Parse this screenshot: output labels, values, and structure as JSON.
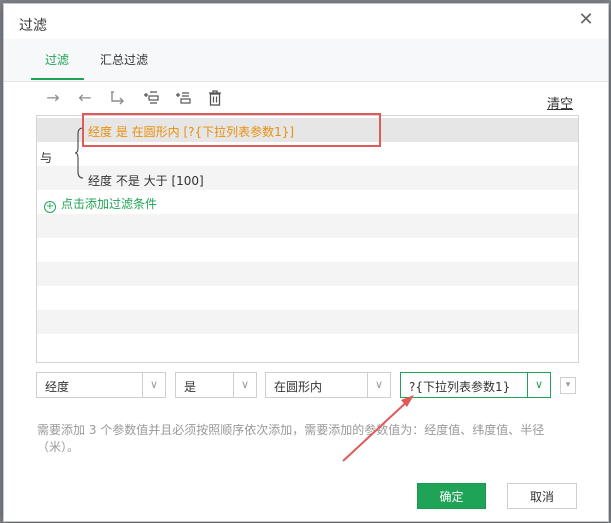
{
  "dialog": {
    "title": "过滤",
    "close_icon": "close-icon"
  },
  "tabs": [
    {
      "label": "过滤",
      "active": true
    },
    {
      "label": "汇总过滤",
      "active": false
    }
  ],
  "toolbar": {
    "icons": [
      "arrow-right-icon",
      "arrow-left-icon",
      "return-arrow-icon",
      "add-condition-icon",
      "add-group-icon",
      "delete-icon"
    ],
    "clear_label": "清空"
  },
  "filter": {
    "and_label": "与",
    "conditions": [
      {
        "text": "经度 是 在圆形内 [?{下拉列表参数1}]",
        "highlighted": true
      },
      {
        "text": "经度 不是 大于 [100]",
        "highlighted": false
      }
    ],
    "add_label": "点击添加过滤条件"
  },
  "editor": {
    "field": "经度",
    "operator": "是",
    "function": "在圆形内",
    "value": "?{下拉列表参数1}"
  },
  "hint": "需要添加 3 个参数值并且必须按照顺序依次添加，需要添加的参数值为：经度值、纬度值、半径（米）。",
  "buttons": {
    "ok": "确定",
    "cancel": "取消"
  },
  "colors": {
    "accent": "#1fa356",
    "highlight": "#e8900c",
    "annotation": "#e05a5a"
  }
}
